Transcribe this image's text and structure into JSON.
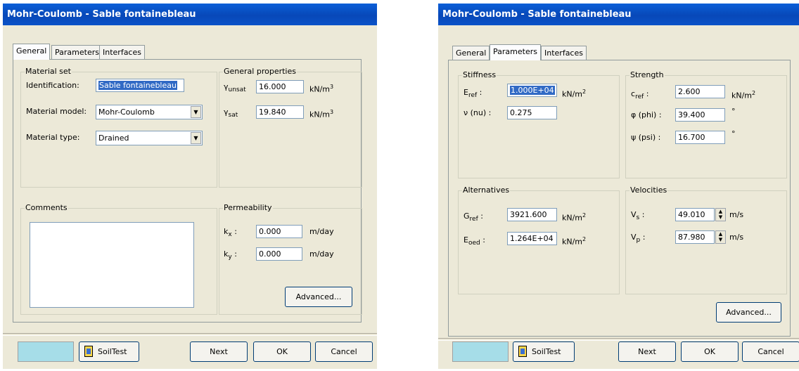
{
  "left": {
    "title": "Mohr-Coulomb - Sable fontainebleau",
    "tabs": [
      "General",
      "Parameters",
      "Interfaces"
    ],
    "material_set": {
      "label": "Material set",
      "identification_label": "Identification:",
      "identification_value": "Sable fontainebleau",
      "model_label": "Material model:",
      "model_value": "Mohr-Coulomb",
      "type_label": "Material type:",
      "type_value": "Drained"
    },
    "general_properties": {
      "label": "General properties",
      "gamma_unsat_sym": "γ",
      "gamma_unsat_sub": "unsat",
      "gamma_unsat_value": "16.000",
      "gamma_sat_sym": "γ",
      "gamma_sat_sub": "sat",
      "gamma_sat_value": "19.840",
      "unit": "kN/m",
      "unit_exp": "3"
    },
    "comments": {
      "label": "Comments"
    },
    "permeability": {
      "label": "Permeability",
      "kx_sym": "k",
      "kx_sub": "x",
      "kx_value": "0.000",
      "ky_sym": "k",
      "ky_sub": "y",
      "ky_value": "0.000",
      "unit": "m/day",
      "colon": ":"
    },
    "advanced": "Advanced...",
    "buttons": {
      "soiltest": "SoilTest",
      "next": "Next",
      "ok": "OK",
      "cancel": "Cancel"
    }
  },
  "right": {
    "title": "Mohr-Coulomb - Sable fontainebleau",
    "tabs": [
      "General",
      "Parameters",
      "Interfaces"
    ],
    "stiffness": {
      "label": "Stiffness",
      "eref_sym": "E",
      "eref_sub": "ref",
      "eref_value": "1.000E+04",
      "nu_label": "ν (nu) :",
      "nu_value": "0.275",
      "unit": "kN/m",
      "unit_exp": "2"
    },
    "strength": {
      "label": "Strength",
      "cref_sym": "c",
      "cref_sub": "ref",
      "cref_value": "2.600",
      "phi_label": "φ (phi) :",
      "phi_value": "39.400",
      "psi_label": "ψ (psi) :",
      "psi_value": "16.700",
      "unit": "kN/m",
      "unit_exp": "2",
      "deg": "°"
    },
    "alternatives": {
      "label": "Alternatives",
      "gref_sym": "G",
      "gref_sub": "ref",
      "gref_value": "3921.600",
      "eoed_sym": "E",
      "eoed_sub": "oed",
      "eoed_value": "1.264E+04",
      "unit": "kN/m",
      "unit_exp": "2"
    },
    "velocities": {
      "label": "Velocities",
      "vs_sym": "V",
      "vs_sub": "s",
      "vs_value": "49.010",
      "vp_sym": "V",
      "vp_sub": "p",
      "vp_value": "87.980",
      "unit": "m/s"
    },
    "colon": ":",
    "advanced": "Advanced...",
    "buttons": {
      "soiltest": "SoilTest",
      "next": "Next",
      "ok": "OK",
      "cancel": "Cancel"
    }
  },
  "colors": {
    "title_bar": "#0a52c8",
    "soil_color": "#a6dde8",
    "selection": "#316ac5"
  }
}
